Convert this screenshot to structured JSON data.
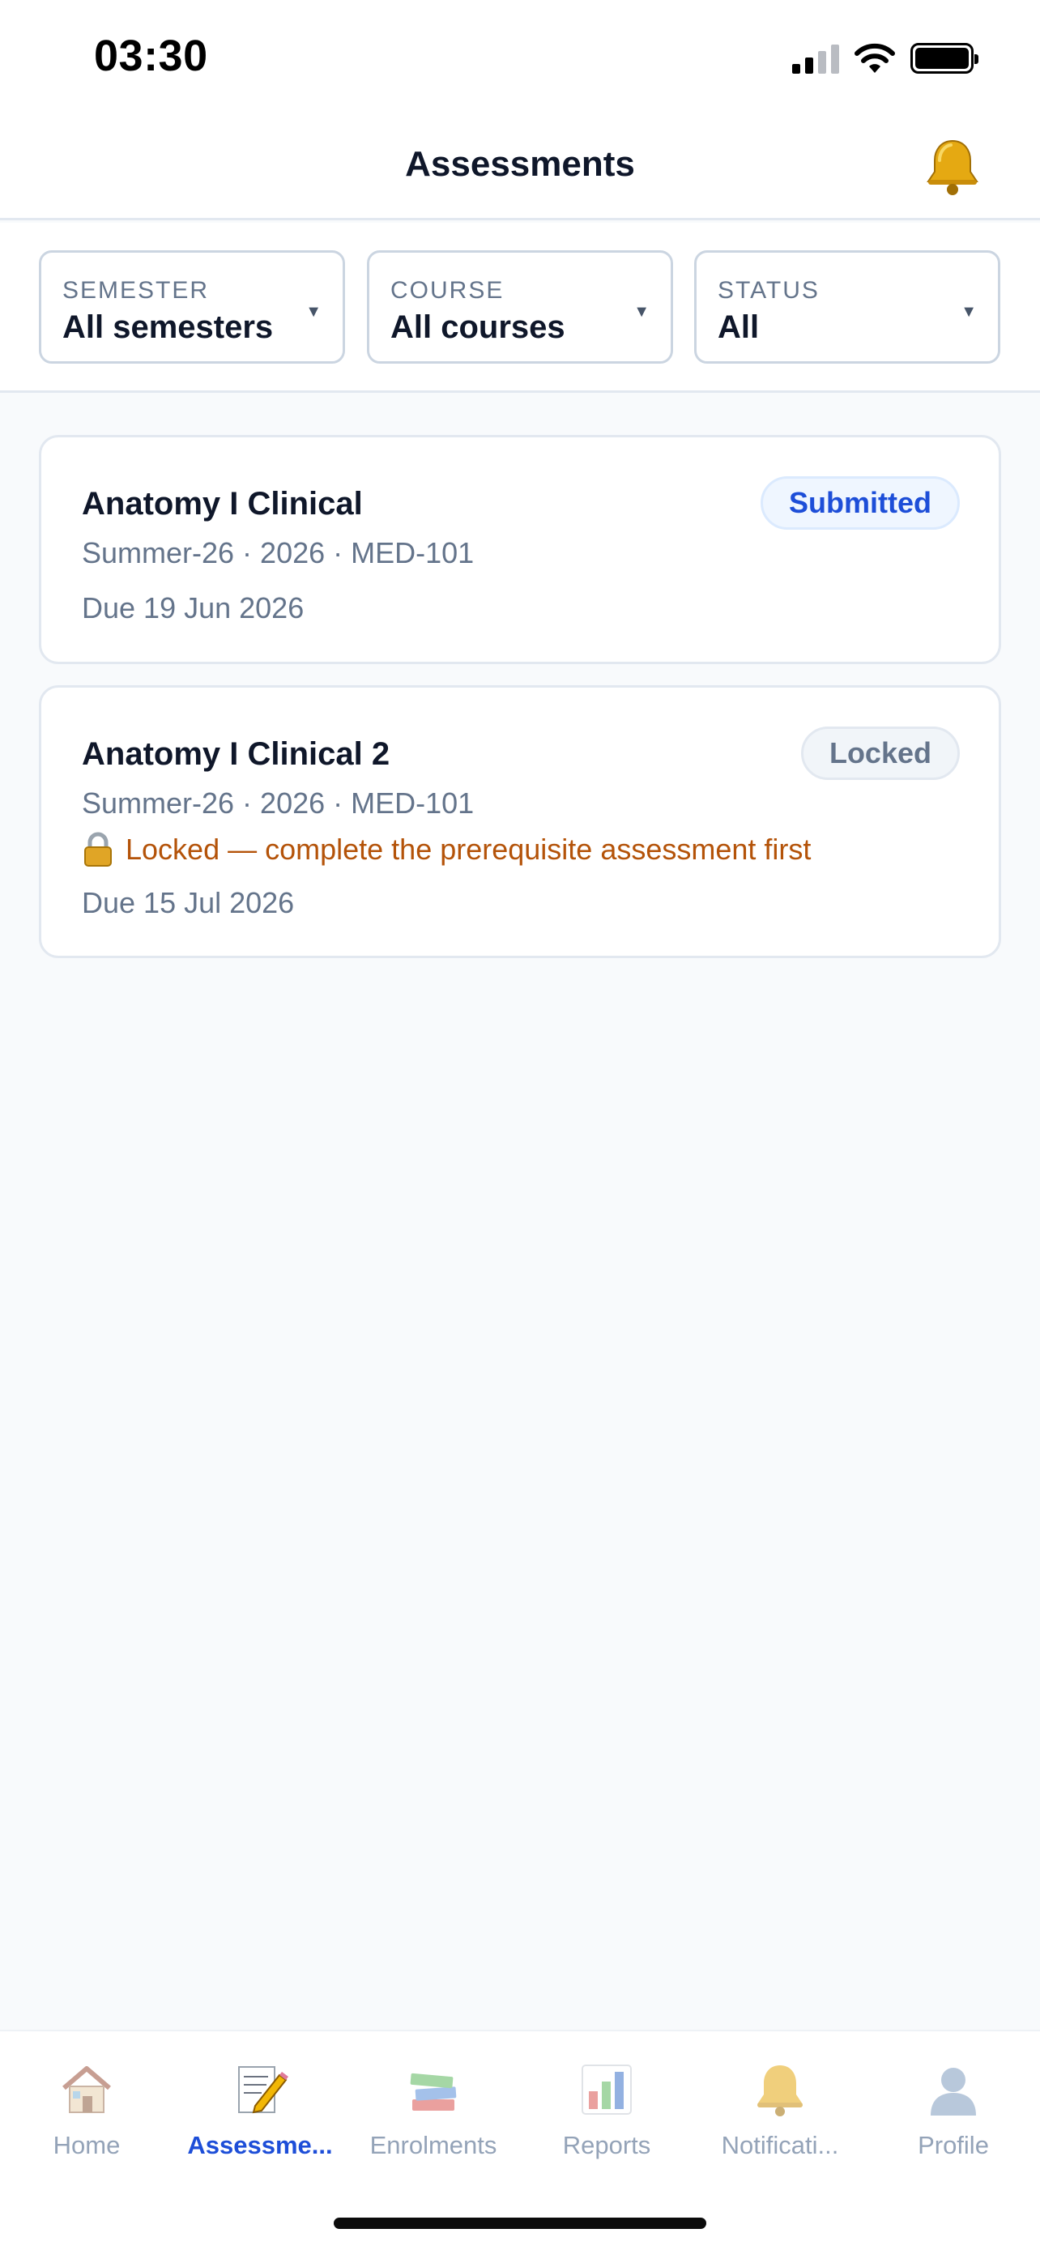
{
  "status_bar": {
    "time": "03:30"
  },
  "header": {
    "title": "Assessments",
    "bell_icon": "bell-icon"
  },
  "filters": [
    {
      "label": "SEMESTER",
      "value": "All semesters"
    },
    {
      "label": "COURSE",
      "value": "All courses"
    },
    {
      "label": "STATUS",
      "value": "All"
    }
  ],
  "assessments": [
    {
      "title": "Anatomy I Clinical",
      "meta": "Summer-26 · 2026 · MED-101",
      "due": "Due 19 Jun 2026",
      "status": "Submitted",
      "lock_message": ""
    },
    {
      "title": "Anatomy I Clinical 2",
      "meta": "Summer-26 · 2026 · MED-101",
      "due": "Due 15 Jul 2026",
      "status": "Locked",
      "lock_message": "Locked — complete the prerequisite assessment first"
    }
  ],
  "tabs": [
    {
      "label": "Home",
      "icon": "house-icon",
      "active": false
    },
    {
      "label": "Assessme...",
      "icon": "memo-icon",
      "active": true
    },
    {
      "label": "Enrolments",
      "icon": "books-icon",
      "active": false
    },
    {
      "label": "Reports",
      "icon": "bar-chart-icon",
      "active": false
    },
    {
      "label": "Notificati...",
      "icon": "bell-icon",
      "active": false
    },
    {
      "label": "Profile",
      "icon": "person-icon",
      "active": false
    }
  ],
  "colors": {
    "accent": "#1d4ed8",
    "locked_warning": "#b45309",
    "muted_text": "#64748b",
    "background": "#f8fafc"
  }
}
